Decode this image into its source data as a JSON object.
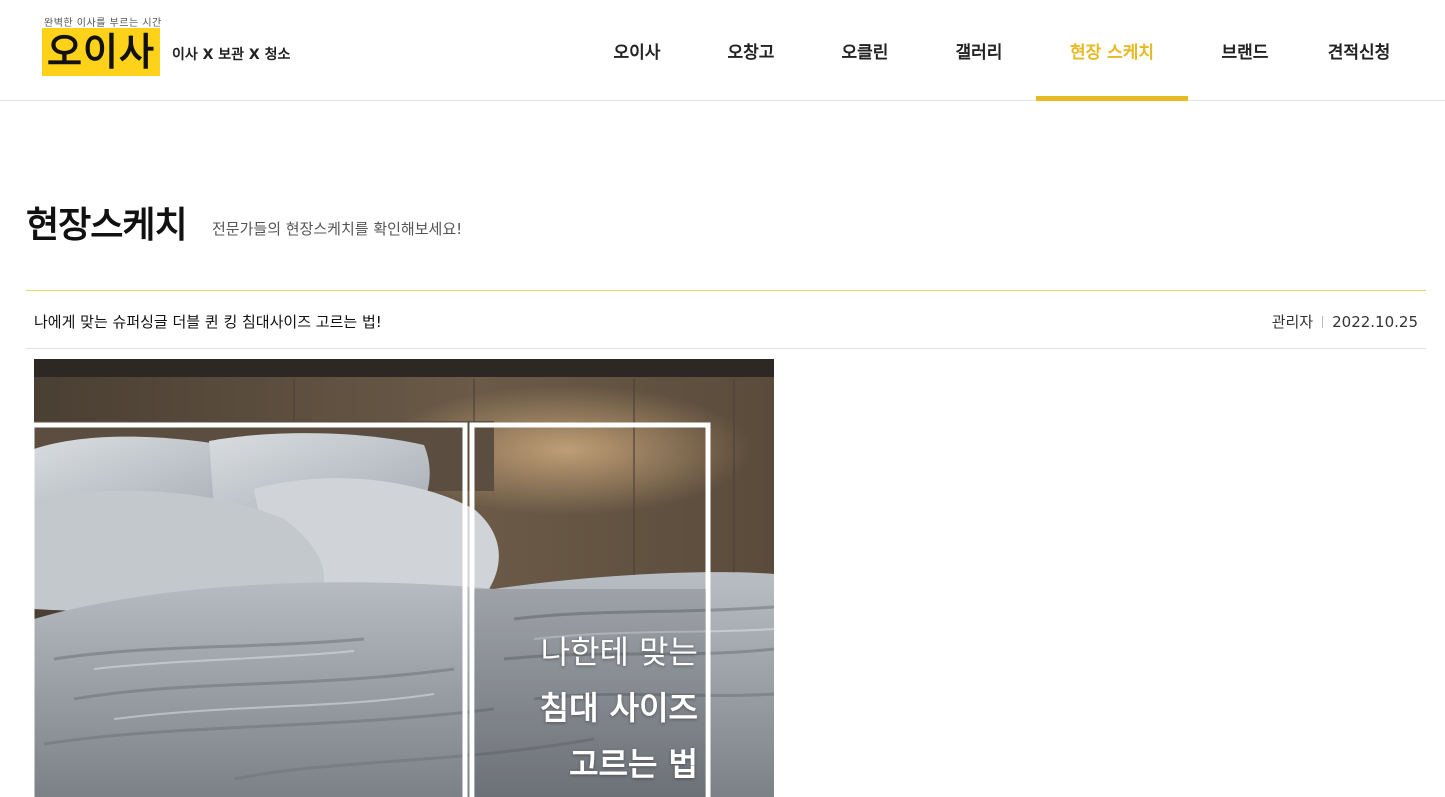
{
  "brand": {
    "tagline": "완벽한 이사를 부르는 시간",
    "logo_text": "오이사",
    "subtitle": "이사 X 보관 X 청소",
    "accent_color": "#ffd21a"
  },
  "nav": {
    "items": [
      {
        "label": "오이사"
      },
      {
        "label": "오창고"
      },
      {
        "label": "오클린"
      },
      {
        "label": "갤러리"
      },
      {
        "label": "현장 스케치",
        "active": true
      },
      {
        "label": "브랜드"
      },
      {
        "label": "견적신청"
      }
    ],
    "active_color": "#e8b923"
  },
  "page": {
    "title": "현장스케치",
    "subtitle": "전문가들의 현장스케치를 확인해보세요!"
  },
  "post": {
    "title": "나에게 맞는 슈퍼싱글 더블 퀸 킹 침대사이즈 고르는 법!",
    "author": "관리자",
    "date": "2022.10.25",
    "image": {
      "line1": "나한테 맞는",
      "line2": "침대 사이즈",
      "line3": "고르는 법"
    }
  }
}
